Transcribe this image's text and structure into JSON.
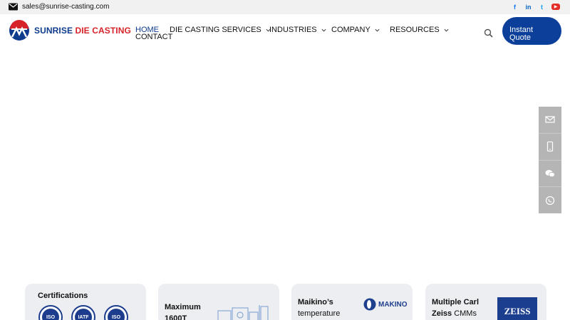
{
  "topbar": {
    "email": "sales@sunrise-casting.com",
    "social": [
      {
        "name": "facebook",
        "glyph": "f"
      },
      {
        "name": "linkedin",
        "glyph": "in"
      },
      {
        "name": "twitter",
        "glyph": "t"
      },
      {
        "name": "youtube",
        "glyph": "▶"
      }
    ]
  },
  "brand": {
    "part1": "SUNRISE",
    "part2": "DIE CASTING"
  },
  "nav": {
    "items": [
      {
        "label": "HOME",
        "active": true
      },
      {
        "label": "DIE CASTING SERVICES"
      },
      {
        "label": "INDUSTRIES"
      },
      {
        "label": "COMPANY"
      },
      {
        "label": "RESOURCES"
      },
      {
        "label": "CONTACT"
      }
    ]
  },
  "cta": {
    "quote_line1": "Instant",
    "quote_line2": "Quote"
  },
  "cards": [
    {
      "title": "Certifications",
      "badges": [
        "ISO",
        "IATF",
        "ISO"
      ]
    },
    {
      "title_line1": "Maximum",
      "title_line2": "1600T"
    },
    {
      "title_line1": "Maikino’s",
      "title_line2": "temperature",
      "logo": "MAKINO"
    },
    {
      "title_line1": "Multiple Carl",
      "title_line2_bold": "Zeiss",
      "title_line2_rest": " CMMs",
      "logo": "ZEISS"
    }
  ],
  "colors": {
    "brand_blue": "#0e3b8c",
    "brand_red": "#d6232a",
    "cta_blue": "#0b3f9a"
  }
}
